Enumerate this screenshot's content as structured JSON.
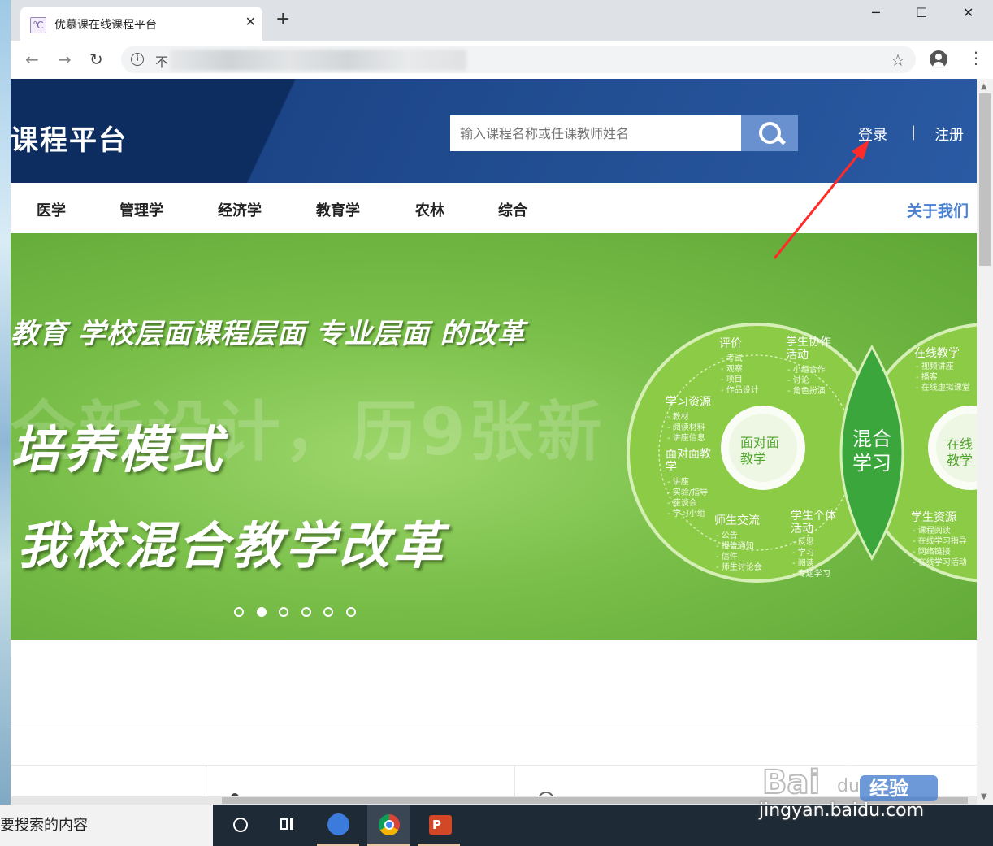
{
  "browser": {
    "tab_title": "优慕课在线课程平台",
    "new_tab": "+",
    "close_tab": "✕",
    "url_prefix": "不",
    "window_controls": {
      "minimize": "─",
      "maximize": "☐",
      "close": "✕"
    }
  },
  "header": {
    "site_title": "课程平台",
    "search_placeholder": "输入课程名称或任课教师姓名",
    "login": "登录",
    "separator": "|",
    "register": "注册"
  },
  "nav": {
    "categories": [
      "医学",
      "管理学",
      "经济学",
      "教育学",
      "农林",
      "综合"
    ],
    "about": "关于我们"
  },
  "banner": {
    "line1": "教育  学校层面课程层面  专业层面  的改革",
    "line2": "培养模式",
    "line3": "我校混合教学改革",
    "ghost": "全新设计，历9张新",
    "diagram": {
      "left_circle": "面对面\n教学",
      "center": "混合\n学习",
      "right_circle": "在线\n教学",
      "labels": [
        {
          "title": "评价",
          "items": "- 考试\n- 观察\n- 项目\n- 作品设计"
        },
        {
          "title": "学生协作\n活动",
          "items": "- 小组合作\n- 讨论\n- 角色扮演"
        },
        {
          "title": "学习资源",
          "items": "- 教材\n- 阅读材料\n- 讲座信息"
        },
        {
          "title": "面对面教\n学",
          "items": "- 讲座\n- 实验/指导\n- 座谈会\n- 学习小组"
        },
        {
          "title": "师生交流",
          "items": "- 公告\n- 报告通知\n- 信件\n- 师生讨论会"
        },
        {
          "title": "学生个体\n活动",
          "items": "- 反思\n- 学习\n- 阅读\n- 专题学习"
        },
        {
          "title": "在线教学",
          "items": "- 视频讲座\n- 播客\n- 在线虚拟课堂"
        },
        {
          "title": "学生资源",
          "items": "- 课程阅读\n- 在线学习指导\n- 网络链接\n- 在线学习活动"
        }
      ]
    },
    "slides_total": 6,
    "active_slide": 2
  },
  "taskbar": {
    "search_text": "要搜索的内容"
  },
  "watermark": {
    "logo": "Bai 经验",
    "url": "jingyan.baidu.com"
  },
  "icons": [
    "info-icon",
    "star-icon",
    "profile-icon",
    "menu-icon",
    "search-icon",
    "back-icon",
    "forward-icon",
    "reload-icon"
  ],
  "colors": {
    "header_dark": "#0d2d60",
    "header_blue": "#2a5aa3",
    "search_btn": "#6990cf",
    "banner_green": "#78be48",
    "about": "#4a80d0",
    "arrow": "#ff2a2a"
  }
}
